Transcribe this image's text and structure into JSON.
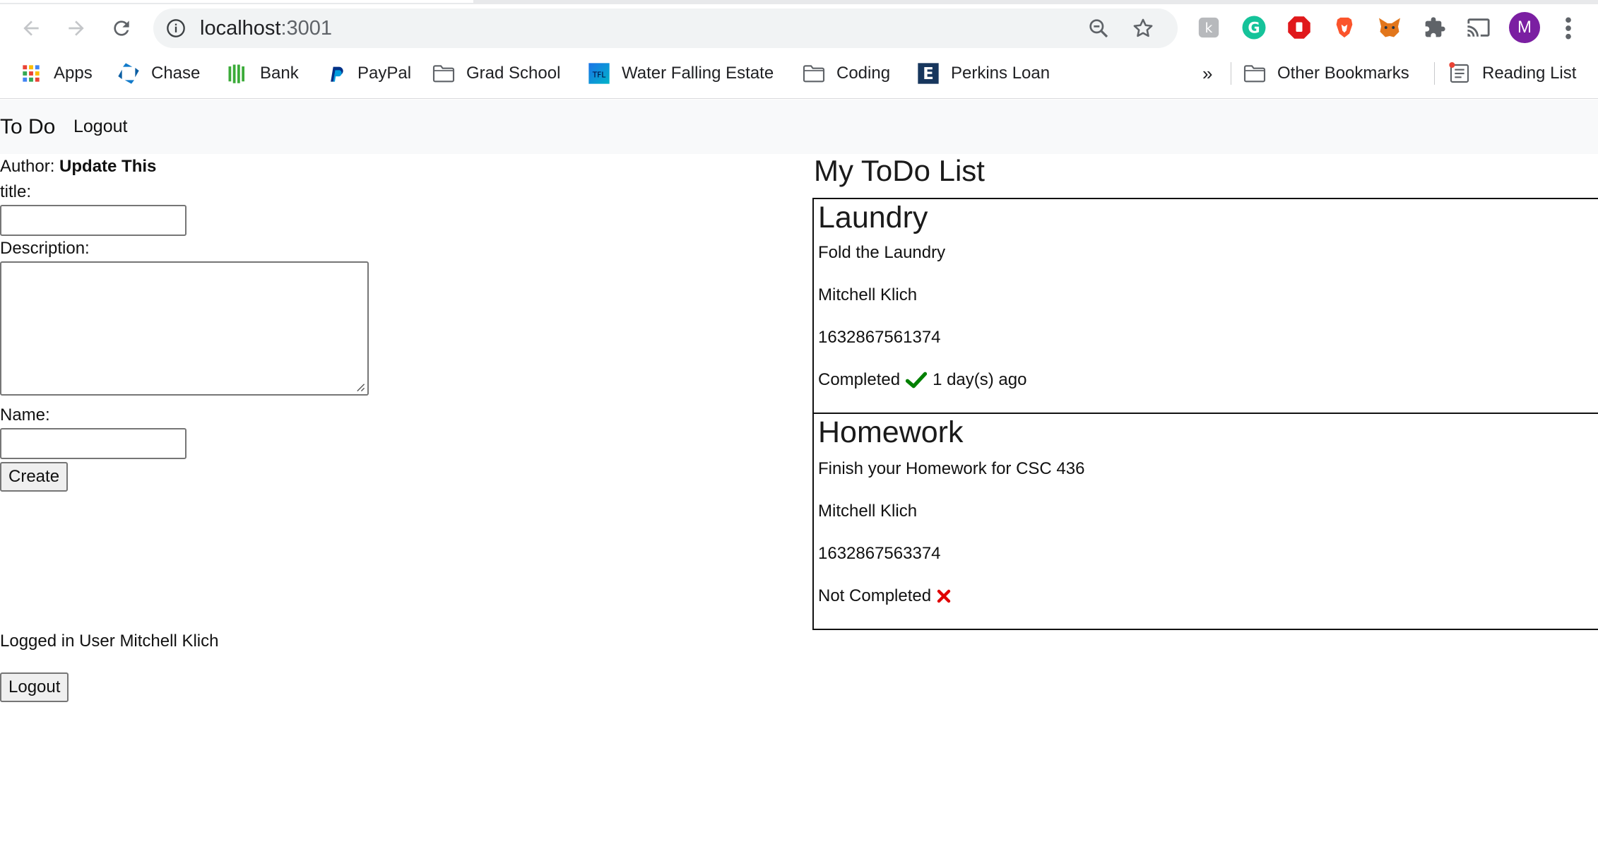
{
  "browser": {
    "url_host": "localhost",
    "url_port": ":3001",
    "avatar_letter": "M",
    "bookmarks": [
      {
        "label": "Apps",
        "icon": "apps-grid-icon"
      },
      {
        "label": "Chase",
        "icon": "chase-icon"
      },
      {
        "label": "Bank",
        "icon": "bank-icon"
      },
      {
        "label": "PayPal",
        "icon": "paypal-icon"
      },
      {
        "label": "Grad School",
        "icon": "folder-icon"
      },
      {
        "label": "Water Falling Estate",
        "icon": "water-falling-estate-icon"
      },
      {
        "label": "Coding",
        "icon": "folder-icon"
      },
      {
        "label": "Perkins Loan",
        "icon": "perkins-loan-icon"
      }
    ],
    "overflow_label": "»",
    "other_bookmarks": "Other Bookmarks",
    "reading_list": "Reading List"
  },
  "navbar": {
    "brand": "To Do",
    "logout": "Logout"
  },
  "form": {
    "author_prefix": "Author: ",
    "author_name": "Update This",
    "title_label": "title:",
    "title_value": "",
    "description_label": "Description:",
    "description_value": "",
    "name_label": "Name:",
    "name_value": "",
    "create_button": "Create"
  },
  "session": {
    "logged_in_text": "Logged in User Mitchell Klich",
    "logout_button": "Logout"
  },
  "todo_list": {
    "heading": "My ToDo List",
    "items": [
      {
        "title": "Laundry",
        "description": "Fold the Laundry",
        "author": "Mitchell Klich",
        "timestamp": "1632867561374",
        "status": "Completed",
        "status_icon": "check-icon",
        "status_color": "#008000",
        "completed_ago": "1 day(s) ago"
      },
      {
        "title": "Homework",
        "description": "Finish your Homework for CSC 436",
        "author": "Mitchell Klich",
        "timestamp": "1632867563374",
        "status": "Not Completed",
        "status_icon": "cross-icon",
        "status_color": "#e00000",
        "completed_ago": ""
      }
    ]
  }
}
